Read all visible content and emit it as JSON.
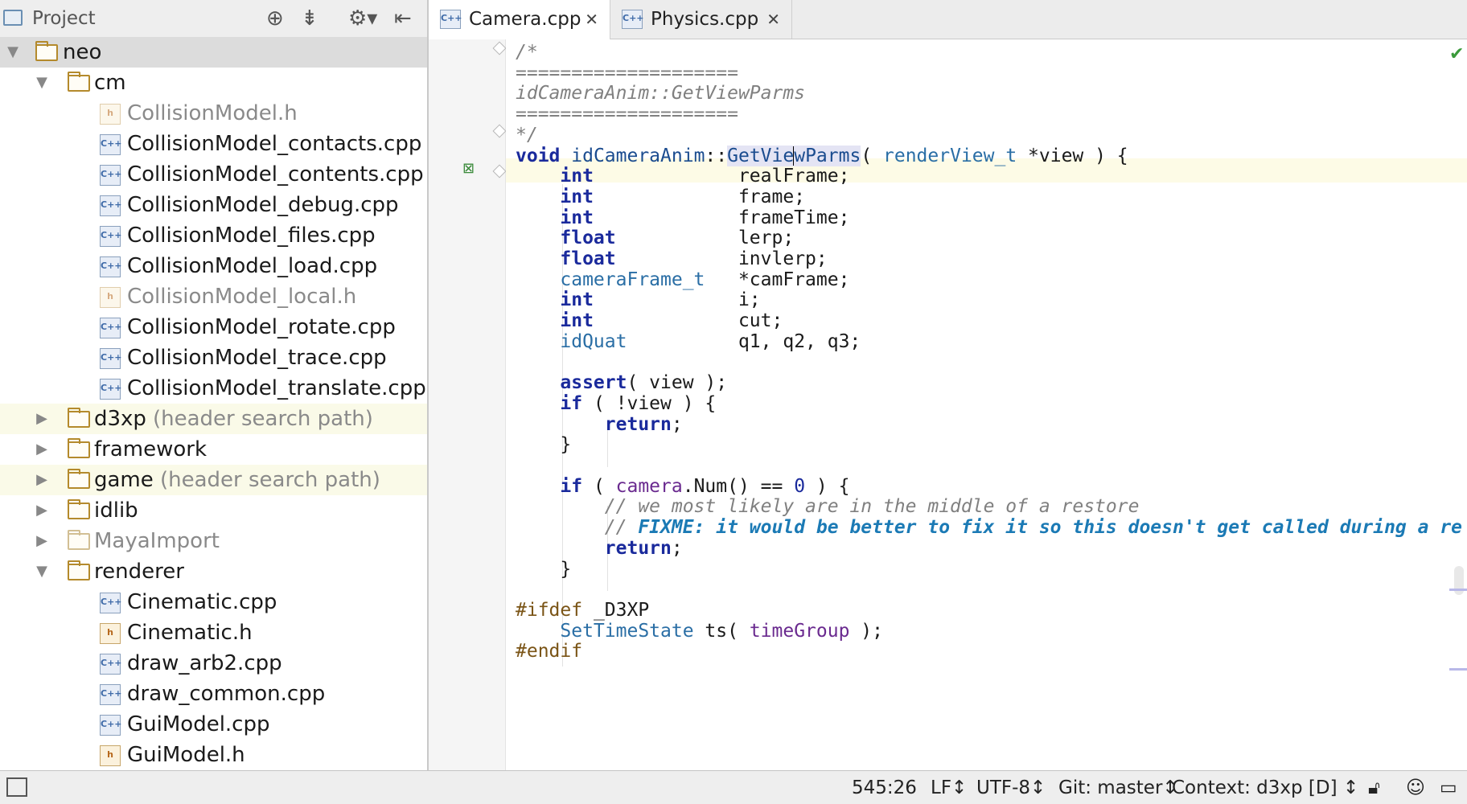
{
  "project_panel": {
    "title": "Project",
    "tools": [
      "crosshair-icon",
      "collapse-icon",
      "gear-icon",
      "hide-icon"
    ],
    "tree": [
      {
        "label": "neo",
        "kind": "folder",
        "depth": 0,
        "arrow": "▼",
        "selected": true
      },
      {
        "label": "cm",
        "kind": "folder",
        "depth": 1,
        "arrow": "▼"
      },
      {
        "label": "CollisionModel.h",
        "kind": "h",
        "depth": 2,
        "dim": true
      },
      {
        "label": "CollisionModel_contacts.cpp",
        "kind": "cpp",
        "depth": 2
      },
      {
        "label": "CollisionModel_contents.cpp",
        "kind": "cpp",
        "depth": 2
      },
      {
        "label": "CollisionModel_debug.cpp",
        "kind": "cpp",
        "depth": 2
      },
      {
        "label": "CollisionModel_files.cpp",
        "kind": "cpp",
        "depth": 2
      },
      {
        "label": "CollisionModel_load.cpp",
        "kind": "cpp",
        "depth": 2
      },
      {
        "label": "CollisionModel_local.h",
        "kind": "h",
        "depth": 2,
        "dim": true
      },
      {
        "label": "CollisionModel_rotate.cpp",
        "kind": "cpp",
        "depth": 2
      },
      {
        "label": "CollisionModel_trace.cpp",
        "kind": "cpp",
        "depth": 2
      },
      {
        "label": "CollisionModel_translate.cpp",
        "kind": "cpp",
        "depth": 2
      },
      {
        "label": "d3xp",
        "hint": "(header search path)",
        "kind": "folder",
        "depth": 1,
        "arrow": "▶",
        "highlight": true
      },
      {
        "label": "framework",
        "kind": "folder",
        "depth": 1,
        "arrow": "▶"
      },
      {
        "label": "game",
        "hint": "(header search path)",
        "kind": "folder",
        "depth": 1,
        "arrow": "▶",
        "highlight": true
      },
      {
        "label": "idlib",
        "kind": "folder",
        "depth": 1,
        "arrow": "▶"
      },
      {
        "label": "MayaImport",
        "kind": "folder",
        "depth": 1,
        "arrow": "▶",
        "dim": true
      },
      {
        "label": "renderer",
        "kind": "folder",
        "depth": 1,
        "arrow": "▼"
      },
      {
        "label": "Cinematic.cpp",
        "kind": "cpp",
        "depth": 2
      },
      {
        "label": "Cinematic.h",
        "kind": "h",
        "depth": 2
      },
      {
        "label": "draw_arb2.cpp",
        "kind": "cpp",
        "depth": 2
      },
      {
        "label": "draw_common.cpp",
        "kind": "cpp",
        "depth": 2
      },
      {
        "label": "GuiModel.cpp",
        "kind": "cpp",
        "depth": 2
      },
      {
        "label": "GuiModel.h",
        "kind": "h",
        "depth": 2
      }
    ]
  },
  "tabs": [
    {
      "label": "Camera.cpp",
      "active": true,
      "close": "✕"
    },
    {
      "label": "Physics.cpp",
      "active": false,
      "close": "✕"
    }
  ],
  "file_icon_text": "C++",
  "header_icon_text": "h",
  "editor": {
    "lines": [
      [
        [
          "cm",
          "/*"
        ]
      ],
      [
        [
          "cm",
          "===================="
        ]
      ],
      [
        [
          "cm",
          "idCameraAnim::GetViewParms"
        ]
      ],
      [
        [
          "cm",
          "===================="
        ]
      ],
      [
        [
          "cm",
          "*/"
        ]
      ],
      [
        [
          "kw",
          "void "
        ],
        [
          "fn",
          "idCameraAnim"
        ],
        [
          "",
          "::"
        ],
        [
          "hl",
          "GetVie"
        ],
        [
          "caret",
          ""
        ],
        [
          "hl",
          "wParms"
        ],
        [
          "",
          "( "
        ],
        [
          "ty",
          "renderView_t"
        ],
        [
          "",
          " *view ) {"
        ]
      ],
      [
        [
          "",
          "    "
        ],
        [
          "kw",
          "int"
        ],
        [
          "",
          "             realFrame;"
        ]
      ],
      [
        [
          "",
          "    "
        ],
        [
          "kw",
          "int"
        ],
        [
          "",
          "             frame;"
        ]
      ],
      [
        [
          "",
          "    "
        ],
        [
          "kw",
          "int"
        ],
        [
          "",
          "             frameTime;"
        ]
      ],
      [
        [
          "",
          "    "
        ],
        [
          "kw",
          "float"
        ],
        [
          "",
          "           lerp;"
        ]
      ],
      [
        [
          "",
          "    "
        ],
        [
          "kw",
          "float"
        ],
        [
          "",
          "           invlerp;"
        ]
      ],
      [
        [
          "",
          "    "
        ],
        [
          "ty",
          "cameraFrame_t"
        ],
        [
          "",
          "   *camFrame;"
        ]
      ],
      [
        [
          "",
          "    "
        ],
        [
          "kw",
          "int"
        ],
        [
          "",
          "             i;"
        ]
      ],
      [
        [
          "",
          "    "
        ],
        [
          "kw",
          "int"
        ],
        [
          "",
          "             cut;"
        ]
      ],
      [
        [
          "",
          "    "
        ],
        [
          "ty",
          "idQuat"
        ],
        [
          "",
          "          q1, q2, q3;"
        ]
      ],
      [
        [
          "",
          ""
        ]
      ],
      [
        [
          "",
          "    "
        ],
        [
          "kw",
          "assert"
        ],
        [
          "",
          "( view );"
        ]
      ],
      [
        [
          "",
          "    "
        ],
        [
          "kw",
          "if"
        ],
        [
          "",
          " ( !view ) {"
        ]
      ],
      [
        [
          "",
          "        "
        ],
        [
          "kw",
          "return"
        ],
        [
          "",
          ";"
        ]
      ],
      [
        [
          "",
          "    }"
        ]
      ],
      [
        [
          "",
          ""
        ]
      ],
      [
        [
          "",
          "    "
        ],
        [
          "kw",
          "if"
        ],
        [
          "",
          " ( "
        ],
        [
          "id2",
          "camera"
        ],
        [
          "",
          ".Num() == "
        ],
        [
          "num",
          "0"
        ],
        [
          "",
          " ) {"
        ]
      ],
      [
        [
          "",
          "        "
        ],
        [
          "cm",
          "// we most likely are in the middle of a restore"
        ]
      ],
      [
        [
          "",
          "        "
        ],
        [
          "cm",
          "// "
        ],
        [
          "todo",
          "FIXME: it would be better to fix it so this doesn't get called during a re"
        ]
      ],
      [
        [
          "",
          "        "
        ],
        [
          "kw",
          "return"
        ],
        [
          "",
          ";"
        ]
      ],
      [
        [
          "",
          "    }"
        ]
      ],
      [
        [
          "",
          ""
        ]
      ],
      [
        [
          "pp",
          "#ifdef"
        ],
        [
          "",
          " _D3XP"
        ]
      ],
      [
        [
          "",
          "    "
        ],
        [
          "ty",
          "SetTimeState"
        ],
        [
          "",
          " ts( "
        ],
        [
          "id2",
          "timeGroup"
        ],
        [
          "",
          " );"
        ]
      ],
      [
        [
          "pp",
          "#endif"
        ]
      ]
    ]
  },
  "status_bar": {
    "position": "545:26",
    "line_ending": "LF↕",
    "encoding": "UTF-8↕",
    "git": "Git: master↕",
    "context": "Context: d3xp [D]",
    "context_arrow": "↕",
    "icons": [
      "lock-icon",
      "inspector-icon",
      "chat-icon"
    ]
  }
}
